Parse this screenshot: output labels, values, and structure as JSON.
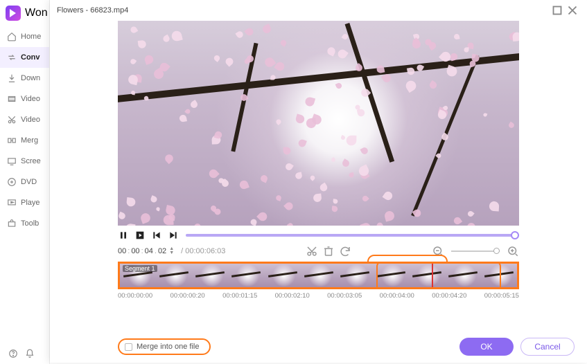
{
  "app": {
    "logo_text": "Won",
    "sidebar": [
      {
        "icon": "home-icon",
        "label": "Home"
      },
      {
        "icon": "convert-icon",
        "label": "Conv",
        "active": true
      },
      {
        "icon": "download-icon",
        "label": "Down"
      },
      {
        "icon": "compress-icon",
        "label": "Video"
      },
      {
        "icon": "edit-icon",
        "label": "Video"
      },
      {
        "icon": "merge-icon",
        "label": "Merg"
      },
      {
        "icon": "screen-icon",
        "label": "Scree"
      },
      {
        "icon": "dvd-icon",
        "label": "DVD"
      },
      {
        "icon": "player-icon",
        "label": "Playe"
      },
      {
        "icon": "toolbox-icon",
        "label": "Toolb"
      }
    ]
  },
  "modal": {
    "title": "Flowers - 66823.mp4",
    "time_current": {
      "h": "00",
      "m": "00",
      "s": "04",
      "f": "02"
    },
    "time_total": "/ 00:00:06:03",
    "segment_label": "Segment 1",
    "ticks": [
      "00:00:00:00",
      "00:00:00:20",
      "00:00:01:15",
      "00:00:02:10",
      "00:00:03:05",
      "00:00:04:00",
      "00:00:04:20",
      "00:00:05:15"
    ],
    "merge_label": "Merge into one file",
    "ok_label": "OK",
    "cancel_label": "Cancel"
  }
}
